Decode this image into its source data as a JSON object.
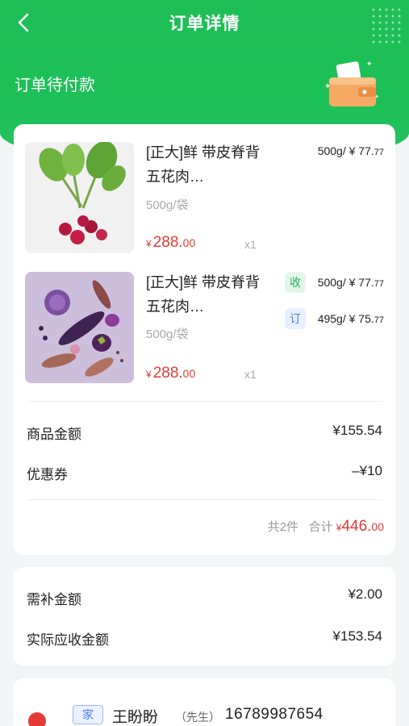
{
  "nav": {
    "title": "订单详情"
  },
  "status": {
    "text": "订单待付款"
  },
  "products": [
    {
      "name": "[正大]鲜 带皮脊背五花肉…",
      "spec": "500g/袋",
      "price_yuan": "¥",
      "price_int": "288.",
      "price_dec": "00",
      "qty": "x1",
      "weight_prices": [
        {
          "tag": "",
          "main": "500g/ ¥ 77.",
          "dec": "77"
        }
      ]
    },
    {
      "name": "[正大]鲜 带皮脊背五花肉…",
      "spec": "500g/袋",
      "price_yuan": "¥",
      "price_int": "288.",
      "price_dec": "00",
      "qty": "x1",
      "weight_prices": [
        {
          "tag": "收",
          "main": "500g/ ¥ 77.",
          "dec": "77"
        },
        {
          "tag": "订",
          "main": "495g/ ¥ 75.",
          "dec": "77"
        }
      ]
    }
  ],
  "totals": {
    "goods_label": "商品金额",
    "goods_value": "¥155.54",
    "coupon_label": "优惠券",
    "coupon_value": "–¥10",
    "count_text": "共2件",
    "sum_label": "合计",
    "sum_yuan": "¥",
    "sum_int": "446.",
    "sum_dec": "00"
  },
  "payment": {
    "extra_label": "需补金额",
    "extra_value": "¥2.00",
    "actual_label": "实际应收金额",
    "actual_value": "¥153.54"
  },
  "address": {
    "tag": "家",
    "name": "王盼盼",
    "suffix": "（先生）",
    "phone": "16789987654"
  },
  "colors": {
    "brand": "#1fbf58",
    "price": "#e53935",
    "tag_blue": "#4f7de8"
  },
  "icons": [
    "back-arrow-icon",
    "wallet-icon",
    "location-pin-icon"
  ]
}
